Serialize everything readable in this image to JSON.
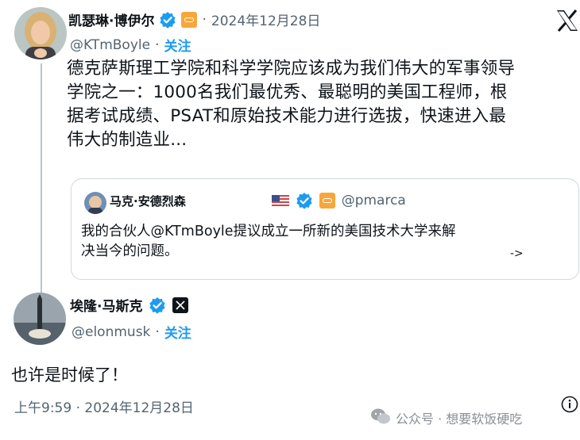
{
  "tweet": {
    "author_name": "凯瑟琳·博伊尔",
    "separator": "·",
    "date": "2024年12月28日",
    "handle": "@KTmBoyle",
    "follow_label": "关注",
    "text_lines": [
      "德克萨斯理工学院和科学学院应该成为我们伟大的军事领导",
      "学院之一：1000名我们最优秀、最聪明的美国工程师，根",
      "据考试成绩、PSAT和原始技术能力进行选拔，快速进入最",
      "伟大的制造业..."
    ]
  },
  "quote": {
    "author_name": "马克·安德烈森",
    "handle": "@pmarca",
    "text_lines": [
      "我的合伙人@KTmBoyle提议成立一所新的美国技术大学来解",
      "决当今的问题。"
    ],
    "more_arrow": "->"
  },
  "reply": {
    "author_name": "埃隆·马斯克",
    "handle": "@elonmusk",
    "follow_label": "关注",
    "text": "也许是时候了！",
    "time": "上午9:59",
    "date": "2024年12月28日",
    "separator": "·"
  },
  "watermark": {
    "text": "公众号 · 想要软饭硬吃"
  },
  "colors": {
    "verified": "#1d9bf0",
    "follow": "#1d9bf0",
    "affiliate": "#f7a73a",
    "muted": "#536471"
  }
}
